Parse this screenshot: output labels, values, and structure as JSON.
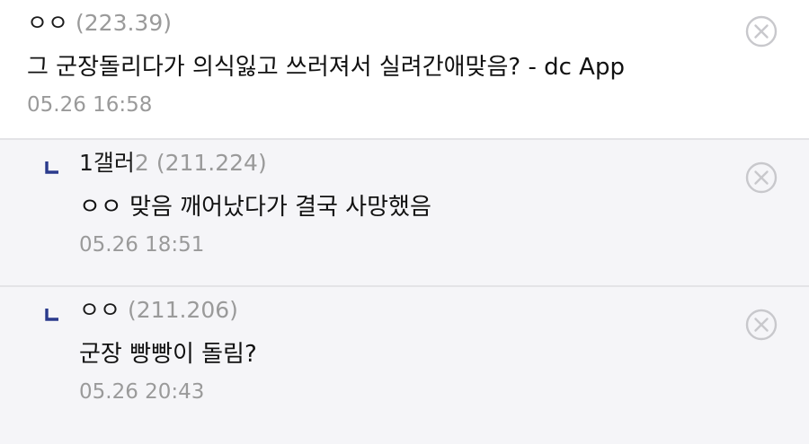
{
  "comments": [
    {
      "nick": "ㅇㅇ",
      "ip": "(223.39)",
      "text": "그 군장돌리다가 의식잃고 쓰러져서 실려간애맞음? - dc App",
      "date": "05.26 16:58",
      "delete_icon": "close-circle-icon"
    },
    {
      "nick": "1갤러",
      "nick_suffix": "2",
      "ip": "(211.224)",
      "text": "ㅇㅇ 맞음 깨어났다가 결국 사망했음",
      "date": "05.26 18:51",
      "reply_icon": "reply-arrow-icon",
      "delete_icon": "close-circle-icon"
    },
    {
      "nick": "ㅇㅇ",
      "ip": "(211.206)",
      "text": "군장 빵빵이 돌림?",
      "date": "05.26 20:43",
      "reply_icon": "reply-arrow-icon",
      "delete_icon": "close-circle-icon"
    }
  ],
  "colors": {
    "reply_mark": "#2a3a8c",
    "delete_icon": "#c8c8cc",
    "reply_bg": "#f5f5f8",
    "meta_text": "#9a9a9a"
  }
}
